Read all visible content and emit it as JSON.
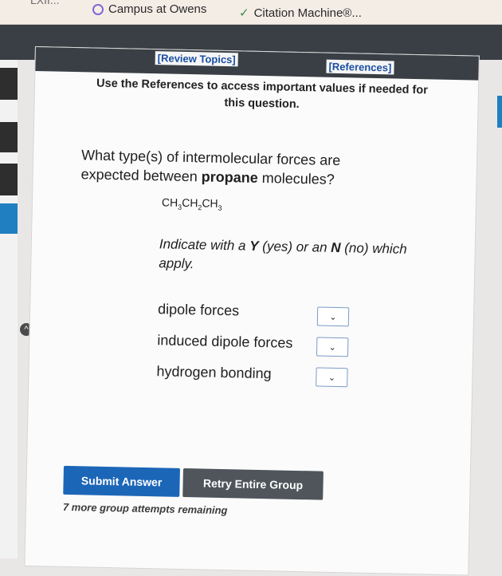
{
  "bookmarks": {
    "partial_prev": "LXII...",
    "item1": "Campus at Owens",
    "item2": "Citation Machine®..."
  },
  "links": {
    "review_topics": "[Review Topics]",
    "references": "[References]"
  },
  "instructions_top": "Use the References to access important values if needed for this question.",
  "question": {
    "prefix": "What type(s) of intermolecular forces are expected between ",
    "bold": "propane",
    "suffix": " molecules?"
  },
  "formula": {
    "p1": "CH",
    "s1": "3",
    "p2": "CH",
    "s2": "2",
    "p3": "CH",
    "s3": "3"
  },
  "instruction": {
    "part1": "Indicate with a ",
    "y": "Y",
    "part2": " (yes) or an ",
    "n": "N",
    "part3": " (no) which apply."
  },
  "options": [
    {
      "label": "dipole forces",
      "value": ""
    },
    {
      "label": "induced dipole forces",
      "value": ""
    },
    {
      "label": "hydrogen bonding",
      "value": ""
    }
  ],
  "buttons": {
    "submit": "Submit Answer",
    "retry": "Retry Entire Group"
  },
  "attempts_text": "7 more group attempts remaining",
  "icons": {
    "dropdown": "chevron-down-icon",
    "scroll": "chevron-up-icon"
  },
  "colors": {
    "submit_bg": "#1c66b8",
    "retry_bg": "#4f555b",
    "header_bg": "#3a3f45"
  }
}
